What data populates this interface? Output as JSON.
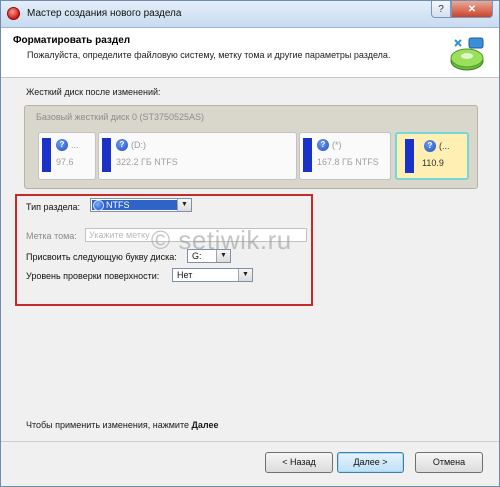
{
  "window": {
    "title": "Мастер создания нового раздела",
    "help_glyph": "?",
    "close_glyph": "✕"
  },
  "header": {
    "title": "Форматировать раздел",
    "subtitle": "Пожалуйста, определите файловую систему, метку тома и другие параметры раздела."
  },
  "disk_section": {
    "label": "Жесткий диск после изменений:",
    "disk_name": "Базовый жесткий диск 0 (ST3750525AS)",
    "partitions": [
      {
        "name": "...",
        "size": "97.6",
        "icon": "unknown-partition-icon"
      },
      {
        "name": "(D:)",
        "size": "322.2 ГБ NTFS",
        "icon": "unknown-partition-icon"
      },
      {
        "name": "(*)",
        "size": "167.8 ГБ NTFS",
        "icon": "unknown-partition-icon"
      },
      {
        "name": "(...",
        "size": "110.9",
        "icon": "unknown-partition-icon",
        "selected": true
      }
    ]
  },
  "form": {
    "fs_label": "Тип раздела:",
    "fs_value": "NTFS",
    "volume_label": "Метка тома:",
    "volume_placeholder": "Укажите метку",
    "drive_letter_label": "Присвоить следующую букву диска:",
    "drive_letter_value": "G:",
    "surface_check_label": "Уровень проверки поверхности:",
    "surface_check_value": "Нет"
  },
  "watermark": "© setiwik.ru",
  "footer": {
    "note_prefix": "Чтобы применить изменения, нажмите",
    "note_bold": "Далее"
  },
  "buttons": {
    "back": "< Назад",
    "next": "Далее >",
    "cancel": "Отмена"
  },
  "colors": {
    "highlight_frame": "#c72a2a",
    "selected_partition": "#ffefb2",
    "partition_bar": "#1a32c8"
  }
}
